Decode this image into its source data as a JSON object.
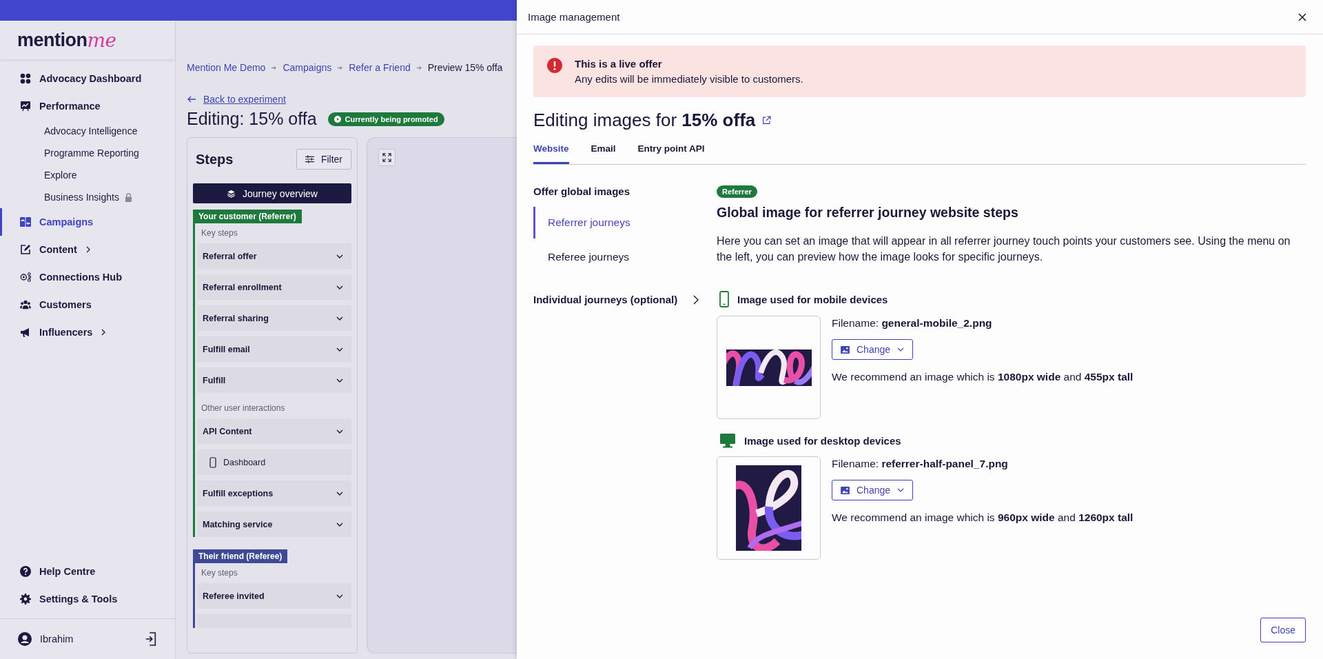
{
  "sidebar": {
    "logo": {
      "word": "mention",
      "accent": "me"
    },
    "nav_items": [
      {
        "label": "Advocacy Dashboard",
        "selected": false,
        "expandable": false
      },
      {
        "label": "Performance",
        "selected": false,
        "expandable": false,
        "children": [
          {
            "label": "Advocacy Intelligence",
            "locked": false
          },
          {
            "label": "Programme Reporting",
            "locked": false
          },
          {
            "label": "Explore",
            "locked": false
          },
          {
            "label": "Business Insights",
            "locked": true
          }
        ]
      },
      {
        "label": "Campaigns",
        "selected": true,
        "expandable": false
      },
      {
        "label": "Content",
        "selected": false,
        "expandable": true
      },
      {
        "label": "Connections Hub",
        "selected": false,
        "expandable": false
      },
      {
        "label": "Customers",
        "selected": false,
        "expandable": false
      },
      {
        "label": "Influencers",
        "selected": false,
        "expandable": true
      }
    ],
    "bottom_items": [
      {
        "label": "Help Centre"
      },
      {
        "label": "Settings & Tools"
      }
    ],
    "user": {
      "name": "Ibrahim"
    }
  },
  "main": {
    "breadcrumbs": [
      {
        "label": "Mention Me Demo",
        "current": false
      },
      {
        "label": "Campaigns",
        "current": false
      },
      {
        "label": "Refer a Friend",
        "current": false
      },
      {
        "label": "Preview 15% offa",
        "current": true
      }
    ],
    "back_link": "Back to experiment",
    "title": "Editing: 15% offa",
    "status_badge": "Currently being promoted",
    "steps_panel": {
      "title": "Steps",
      "filter_button": "Filter",
      "overview_button": "Journey overview",
      "groups": [
        {
          "label": "Your customer (Referrer)",
          "color": "#1e7a3c",
          "sections": [
            {
              "heading": "Key steps",
              "steps": [
                {
                  "label": "Referral offer",
                  "kind": "accordion"
                },
                {
                  "label": "Referral enrollment",
                  "kind": "accordion"
                },
                {
                  "label": "Referral sharing",
                  "kind": "accordion"
                },
                {
                  "label": "Fulfill email",
                  "kind": "accordion"
                },
                {
                  "label": "Fulfill",
                  "kind": "accordion"
                }
              ]
            },
            {
              "heading": "Other user interactions",
              "steps": [
                {
                  "label": "API Content",
                  "kind": "accordion"
                },
                {
                  "label": "Dashboard",
                  "kind": "device"
                },
                {
                  "label": "Fulfill exceptions",
                  "kind": "accordion"
                },
                {
                  "label": "Matching service",
                  "kind": "accordion"
                }
              ]
            }
          ]
        },
        {
          "label": "Their friend (Referee)",
          "color": "#3e4a94",
          "sections": [
            {
              "heading": "Key steps",
              "steps": [
                {
                  "label": "Referee invited",
                  "kind": "accordion"
                }
              ]
            }
          ]
        }
      ]
    }
  },
  "modal": {
    "title": "Image management",
    "alert": {
      "title": "This is a live offer",
      "message": "Any edits will be immediately visible to customers."
    },
    "heading": "Editing images for **15% offa**",
    "tabs": [
      {
        "label": "Website",
        "selected": true
      },
      {
        "label": "Email",
        "selected": false
      },
      {
        "label": "Entry point API",
        "selected": false
      }
    ],
    "side_nav": {
      "heading": "Offer global images",
      "items": [
        {
          "label": "Referrer journeys",
          "selected": true
        },
        {
          "label": "Referee journeys",
          "selected": false
        }
      ],
      "individual": "Individual journeys (optional)"
    },
    "content": {
      "badge": "Referrer",
      "title": "Global image for referrer journey website steps",
      "description": "Here you can set an image that will appear in all referrer journey touch points your customers see. Using the menu on the left, you can preview how the image looks for specific journeys.",
      "images": [
        {
          "kind": "mobile",
          "label": "Image used for mobile devices",
          "filename": "Filename: **general-mobile_2.png**",
          "button": "Change",
          "recommendation": "We recommend an image which is **1080px wide** and **455px tall**"
        },
        {
          "kind": "desktop",
          "label": "Image used for desktop devices",
          "filename": "Filename: **referrer-half-panel_7.png**",
          "button": "Change",
          "recommendation": "We recommend an image which is **960px wide** and **1260px tall**"
        }
      ]
    },
    "close_button": "Close"
  }
}
